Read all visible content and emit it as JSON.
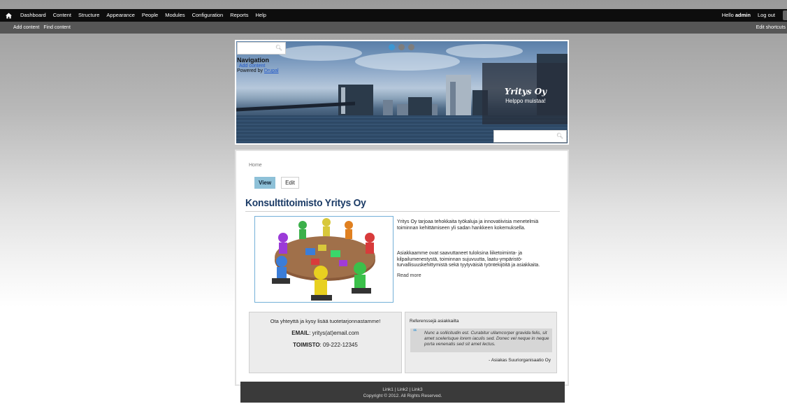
{
  "toolbar": {
    "menu": [
      "Dashboard",
      "Content",
      "Structure",
      "Appearance",
      "People",
      "Modules",
      "Configuration",
      "Reports",
      "Help"
    ],
    "greeting": "Hello",
    "user": "admin",
    "logout": "Log out"
  },
  "shortcuts": {
    "add_content": "Add content",
    "find_content": "Find content",
    "edit_shortcuts": "Edit shortcuts"
  },
  "header": {
    "navigation_title": "Navigation",
    "nav_link": "Add content",
    "powered_by": "Powered by",
    "powered_link": "Drupal",
    "site_name": "Yritys Oy",
    "site_slogan": "Helppo muistaa!"
  },
  "main": {
    "breadcrumb": "Home",
    "tabs": {
      "view": "View",
      "edit": "Edit"
    },
    "title": "Konsulttitoimisto Yritys Oy",
    "intro_1": "Yritys Oy tarjoaa tehokkaita työkaluja ja innovatiivisia menetelmiä toiminnan kehittämiseen yli sadan hankkeen kokemuksella.",
    "intro_2": "Asiakkaamme ovat saavuttaneet tuloksina liiketoiminta- ja kilpailumenestystä, toiminnan sujuvuutta, laatu-ympäristö-turvallisuuskehittymistä sekä tyytyväisiä työntekijöitä ja asiakkaita.",
    "read_more": "Read more"
  },
  "contact": {
    "cta": "Ota yhteyttä ja kysy lisää tuotetarjonnastamme!",
    "email_label": "EMAIL",
    "email_value": ": yritys(at)email.com",
    "phone_label": "TOIMISTO",
    "phone_value": ": 09-222-12345"
  },
  "references": {
    "heading": "Referenssejä asiakkailta",
    "quote": "Nunc a sollicitudin est. Curabitur ullamcorper gravida felis, sit amet scelerisque lorem iaculis sed. Donec vel neque in neque porta venenatis sed sit amet lectus.",
    "author": "- Asiakas Suuriorganisaatio Oy"
  },
  "footer": {
    "link1": "Link1",
    "link2": "Link2",
    "link3": "Link3",
    "separator": " | ",
    "copyright": "Copyright © 2012. All Rights Reserved."
  },
  "icons": {
    "home": "home-icon",
    "search": "search-icon",
    "quote": "quote-icon"
  },
  "colors": {
    "toolbar_bg": "#0d0d0d",
    "shortcuts_bg": "#565656",
    "accent": "#3b97d3",
    "title": "#1b3b66",
    "view_tab": "#8ec1d8",
    "footer_bg": "#3a3a3a"
  }
}
